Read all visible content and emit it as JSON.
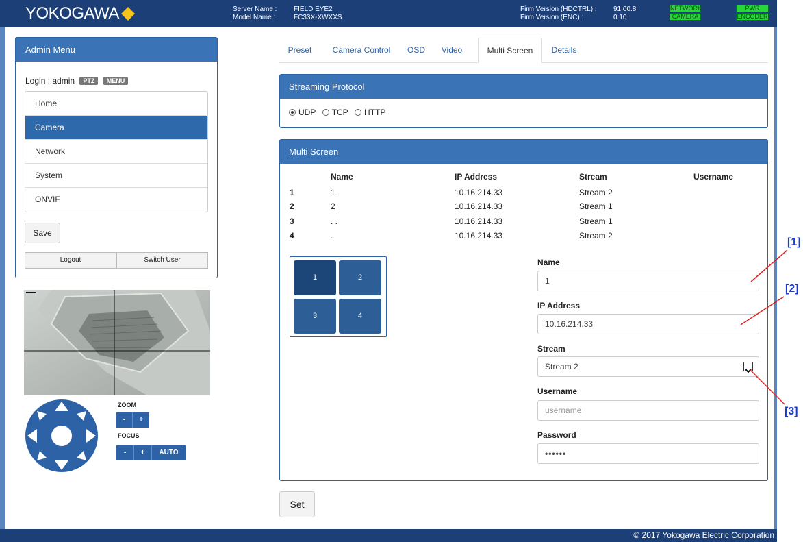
{
  "header": {
    "logo": "YOKOGAWA",
    "server_name_label": "Server Name :",
    "server_name": "FIELD EYE2",
    "model_name_label": "Model Name :",
    "model_name": "FC33X-XWXXS",
    "firm_hdctrl_label": "Firm Version (HDCTRL) :",
    "firm_hdctrl": "91.00.8",
    "firm_enc_label": "Firm Version (ENC) :",
    "firm_enc": "0.10",
    "indicators": [
      "NETWORK",
      "PWR",
      "CAMERA",
      "ENCODER"
    ]
  },
  "admin_menu": {
    "title": "Admin Menu",
    "login_text": "Login : admin",
    "tags": [
      "PTZ",
      "MENU"
    ],
    "items": [
      {
        "label": "Home",
        "active": false
      },
      {
        "label": "Camera",
        "active": true
      },
      {
        "label": "Network",
        "active": false
      },
      {
        "label": "System",
        "active": false
      },
      {
        "label": "ONVIF",
        "active": false
      }
    ],
    "save_label": "Save",
    "logout_label": "Logout",
    "switch_user_label": "Switch User"
  },
  "ptz": {
    "zoom_label": "ZOOM",
    "focus_label": "FOCUS",
    "minus": "-",
    "plus": "+",
    "auto": "AUTO"
  },
  "tabs": [
    {
      "label": "Preset",
      "active": false
    },
    {
      "label": "Camera Control",
      "active": false
    },
    {
      "label": "OSD",
      "active": false
    },
    {
      "label": "Video",
      "active": false
    },
    {
      "label": "Multi Screen",
      "active": true
    },
    {
      "label": "Details",
      "active": false
    }
  ],
  "streaming_protocol": {
    "title": "Streaming Protocol",
    "options": [
      "UDP",
      "TCP",
      "HTTP"
    ],
    "selected": "UDP"
  },
  "multi_screen": {
    "title": "Multi Screen",
    "columns": [
      "Name",
      "IP Address",
      "Stream",
      "Username"
    ],
    "rows": [
      {
        "no": "1",
        "name": "1",
        "ip": "10.16.214.33",
        "stream": "Stream 2",
        "username": ""
      },
      {
        "no": "2",
        "name": "2",
        "ip": "10.16.214.33",
        "stream": "Stream 1",
        "username": ""
      },
      {
        "no": "3",
        "name": ". .",
        "ip": "10.16.214.33",
        "stream": "Stream 1",
        "username": ""
      },
      {
        "no": "4",
        "name": ".",
        "ip": "10.16.214.33",
        "stream": "Stream 2",
        "username": ""
      }
    ],
    "grid_cells": [
      "1",
      "2",
      "3",
      "4"
    ],
    "selected_cell": "1",
    "form": {
      "name_label": "Name",
      "name_value": "1",
      "ip_label": "IP Address",
      "ip_value": "10.16.214.33",
      "stream_label": "Stream",
      "stream_value": "Stream 2",
      "username_label": "Username",
      "username_placeholder": "username",
      "password_label": "Password",
      "password_value": "••••••"
    },
    "set_label": "Set"
  },
  "callouts": [
    "[1]",
    "[2]",
    "[3]"
  ],
  "footer": {
    "copyright": "© 2017 Yokogawa Electric Corporation"
  },
  "colors": {
    "header_bg": "#1c3f78",
    "panel_head": "#3a74b6",
    "accent": "#2d63a6",
    "indicator_green": "#27d63a",
    "callout_red": "#e0201e",
    "callout_blue": "#1a3bd6"
  }
}
